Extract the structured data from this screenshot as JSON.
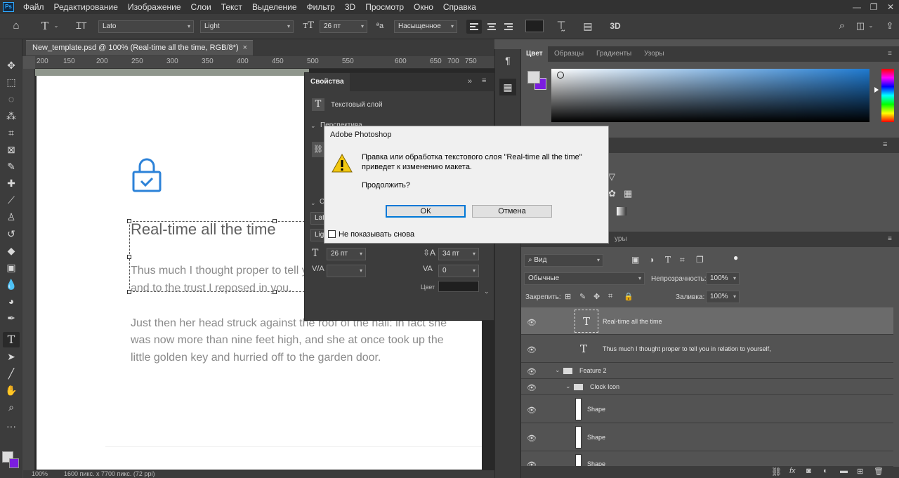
{
  "menu": {
    "logo": "Ps",
    "items": [
      "Файл",
      "Редактирование",
      "Изображение",
      "Слои",
      "Текст",
      "Выделение",
      "Фильтр",
      "3D",
      "Просмотр",
      "Окно",
      "Справка"
    ],
    "window_controls": [
      "—",
      "❐",
      "✕"
    ]
  },
  "options": {
    "font_family": "Lato",
    "font_style": "Light",
    "font_size": "26 пт",
    "antialias_symbol": "ªa",
    "antialias": "Насыщенное",
    "mode3d": "3D"
  },
  "document": {
    "tab_title": "New_template.psd @ 100% (Real-time all the time, RGB/8*)",
    "tab_close": "×",
    "zoom": "100%",
    "doc_size": "1600 пикс. x 7700 пикс. (72 ppi)",
    "ruler_labels": [
      "200",
      "150",
      "200",
      "250",
      "300",
      "350",
      "400",
      "450",
      "500",
      "550",
      "600",
      "650",
      "700",
      "750"
    ]
  },
  "canvas": {
    "heading": "Real-time all the time",
    "para1_line1": "Thus much I thought proper to tell you in relation to yourself,",
    "para1_line2": "and to the trust I reposed in you.",
    "para2_line1": "Just then her head struck against the roof of the hall: in fact she",
    "para2_line2": "was now more than nine feet high, and she at once took up the",
    "para2_line3": "little golden key and hurried off to the garden door.",
    "lock_color": "#2c82d8"
  },
  "properties": {
    "title": "Свойства",
    "layer_type": "Текстовый слой",
    "section_transform": "Перспектива",
    "section_char": "С",
    "font_short": "Lato",
    "style_short": "Light",
    "size": "26 пт",
    "leading": "34 пт",
    "tracking": "0",
    "color_label": "Цвет"
  },
  "color_panel": {
    "tabs": [
      "Цвет",
      "Образцы",
      "Градиенты",
      "Узоры"
    ],
    "accent": "#2c82d8"
  },
  "layers": {
    "tab_partial": "уры",
    "filter": "Вид",
    "blend": "Обычные",
    "opacity_label": "Непрозрачность:",
    "opacity": "100%",
    "lock_label": "Закрепить:",
    "fill_label": "Заливка:",
    "fill": "100%",
    "rows": [
      {
        "name": "Real-time all the time",
        "kind": "text",
        "selected": true
      },
      {
        "name": "Thus much I thought proper to tell you in relation to yourself,",
        "kind": "text",
        "selected": false
      },
      {
        "name": "Feature 2",
        "kind": "group",
        "selected": false
      },
      {
        "name": "Clock Icon",
        "kind": "group",
        "selected": false
      },
      {
        "name": "Shape",
        "kind": "shape",
        "selected": false
      },
      {
        "name": "Shape",
        "kind": "shape",
        "selected": false
      },
      {
        "name": "Shape",
        "kind": "shape",
        "selected": false
      }
    ]
  },
  "dialog": {
    "title": "Adobe Photoshop",
    "message_line1": "Правка или обработка текстового слоя  \"Real-time all the time\"",
    "message_line2": "приведет к изменению макета.",
    "question": "Продолжить?",
    "ok": "ОК",
    "cancel": "Отмена",
    "dont_show": "Не показывать снова"
  }
}
